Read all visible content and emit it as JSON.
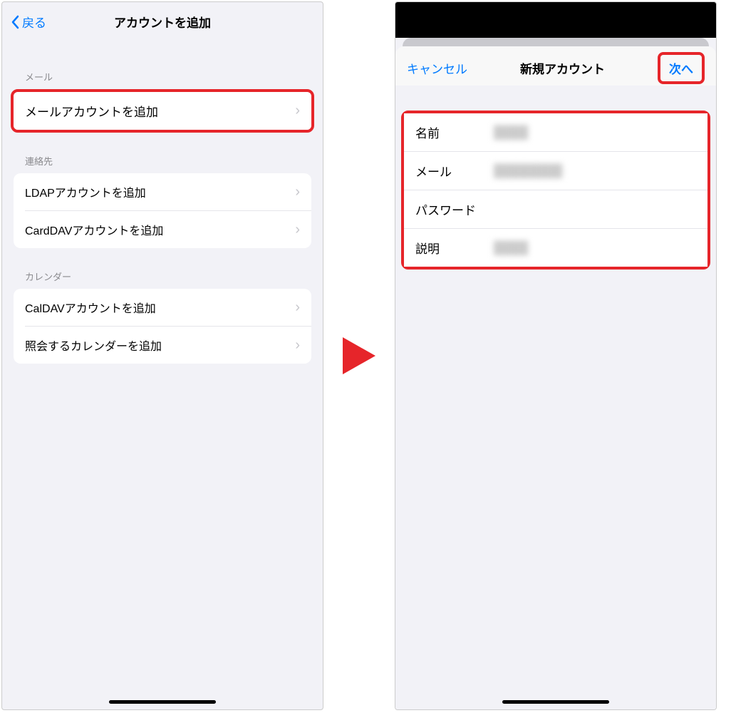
{
  "left": {
    "back": "戻る",
    "title": "アカウントを追加",
    "sections": {
      "mail": {
        "header": "メール",
        "items": [
          "メールアカウントを追加"
        ]
      },
      "contacts": {
        "header": "連絡先",
        "items": [
          "LDAPアカウントを追加",
          "CardDAVアカウントを追加"
        ]
      },
      "calendar": {
        "header": "カレンダー",
        "items": [
          "CalDAVアカウントを追加",
          "照会するカレンダーを追加"
        ]
      }
    }
  },
  "right": {
    "cancel": "キャンセル",
    "title": "新規アカウント",
    "next": "次へ",
    "fields": {
      "name": "名前",
      "mail": "メール",
      "password": "パスワード",
      "desc": "説明"
    },
    "blurred": {
      "name": "████",
      "mail": "████████",
      "password": "",
      "desc": "████"
    }
  }
}
